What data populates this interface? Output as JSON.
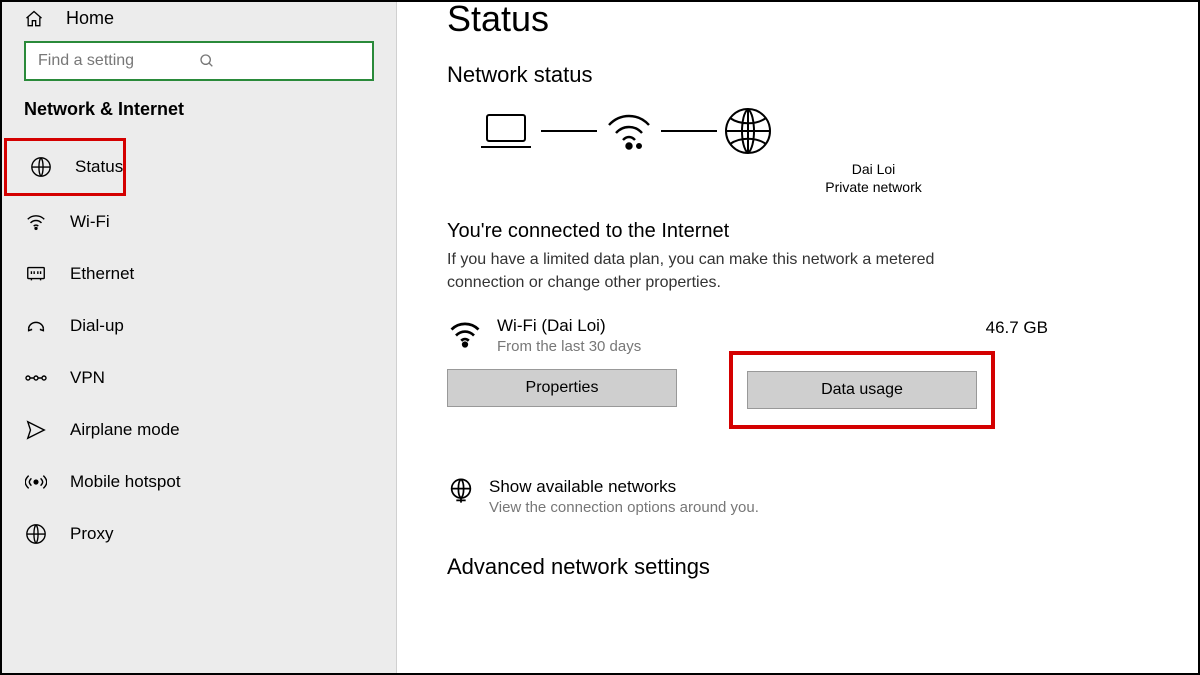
{
  "sidebar": {
    "home": "Home",
    "search_placeholder": "Find a setting",
    "category": "Network & Internet",
    "items": [
      {
        "label": "Status"
      },
      {
        "label": "Wi-Fi"
      },
      {
        "label": "Ethernet"
      },
      {
        "label": "Dial-up"
      },
      {
        "label": "VPN"
      },
      {
        "label": "Airplane mode"
      },
      {
        "label": "Mobile hotspot"
      },
      {
        "label": "Proxy"
      }
    ]
  },
  "main": {
    "title": "Status",
    "network_status": "Network status",
    "diagram": {
      "ssid": "Dai Loi",
      "network_type": "Private network"
    },
    "connected": {
      "heading": "You're connected to the Internet",
      "sub": "If you have a limited data plan, you can make this network a metered connection or change other properties."
    },
    "adapter": {
      "name": "Wi-Fi (Dai Loi)",
      "period": "From the last 30 days",
      "usage": "46.7 GB",
      "properties_btn": "Properties",
      "data_usage_btn": "Data usage"
    },
    "available": {
      "title": "Show available networks",
      "sub": "View the connection options around you."
    },
    "advanced": "Advanced network settings"
  }
}
